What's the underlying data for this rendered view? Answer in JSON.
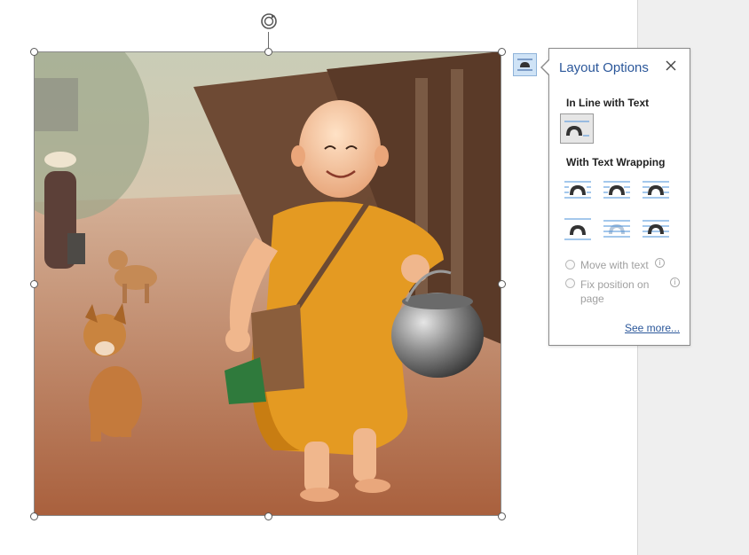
{
  "layout_options": {
    "title": "Layout Options",
    "inline_section": "In Line with Text",
    "wrap_section": "With Text Wrapping",
    "move_with_text": "Move with text",
    "fix_position_line1": "Fix position on",
    "fix_position_line2": "page",
    "see_more": "See more...",
    "selected_option": "In Line with Text"
  },
  "icons": {
    "trigger": "layout-options-icon",
    "close": "close-icon",
    "rotate": "rotate-handle-icon",
    "info": "info-icon"
  },
  "colors": {
    "accent": "#2b579a",
    "wrap_lines": "#4a90d9",
    "selected_fill": "#e6e6e6",
    "gutter": "#efefef"
  }
}
